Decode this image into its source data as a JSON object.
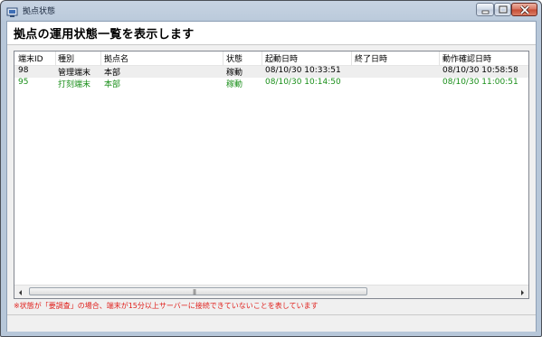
{
  "window": {
    "title": "拠点状態"
  },
  "header": {
    "title": "拠点の運用状態一覧を表示します"
  },
  "table": {
    "columns": [
      "端末ID",
      "種別",
      "拠点名",
      "状態",
      "起動日時",
      "終了日時",
      "動作確認日時"
    ],
    "rows": [
      {
        "id": "98",
        "type": "管理端末",
        "site": "本部",
        "status": "稼動",
        "start": "08/10/30 10:33:51",
        "end": "",
        "checked": "08/10/30 10:58:58"
      },
      {
        "id": "95",
        "type": "打刻端末",
        "site": "本部",
        "status": "稼動",
        "start": "08/10/30 10:14:50",
        "end": "",
        "checked": "08/10/30 11:00:51"
      }
    ]
  },
  "footer": {
    "note": "※状態が「要調査」の場合、端末が15分以上サーバーに接続できていないことを表しています"
  },
  "colors": {
    "normal_text": "#000000",
    "active_row_text": "#1a8f1a",
    "note_text": "#e0201c"
  }
}
